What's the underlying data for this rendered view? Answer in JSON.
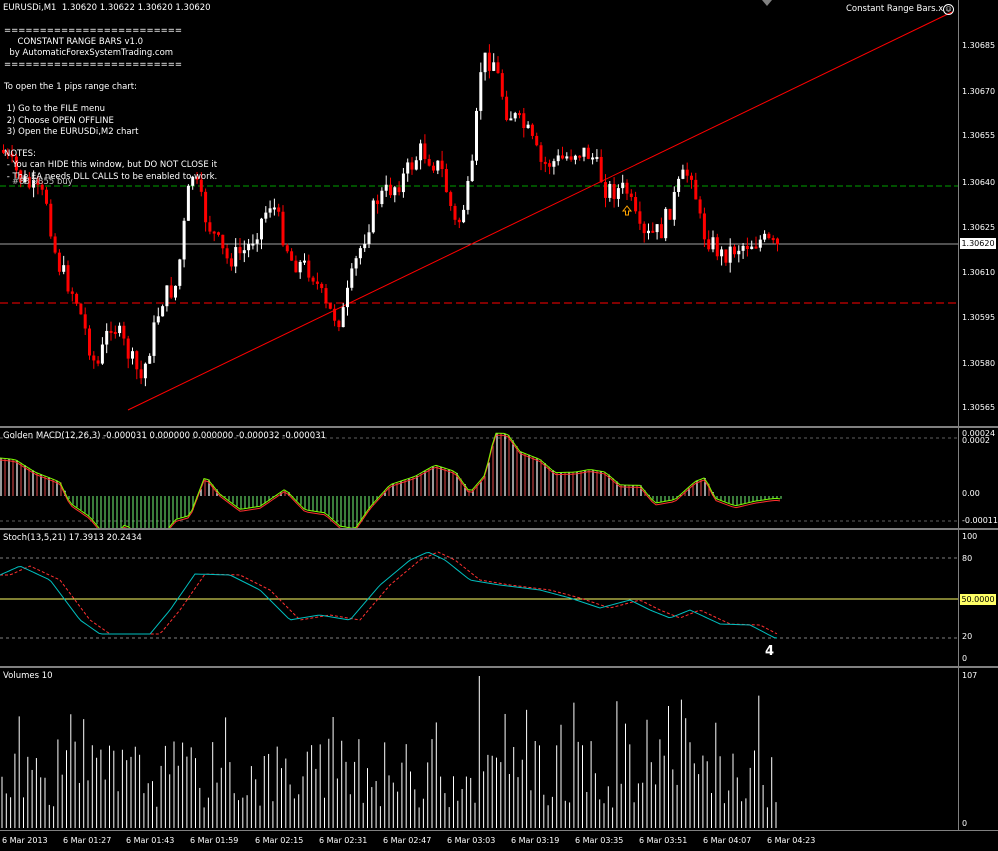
{
  "main": {
    "symbol_line": "EURUSDi,M1  1.30620 1.30622 1.30620 1.30620",
    "ea_label": "Constant Range Bars.x",
    "panel_lines": [
      "=========================",
      "     CONSTANT RANGE BARS v1.0",
      "  by AutomaticForexSystemTrading.com",
      "=========================",
      "",
      "To open the 1 pips range chart:",
      "",
      " 1) Go to the FILE menu",
      " 2) Choose OPEN OFFLINE",
      " 3) Open the EURUSDi,M2 chart",
      "",
      "NOTES:",
      " - You can HIDE this window, but DO NOT CLOSE it",
      " - The EA needs DLL CALLS to be enabled to work."
    ],
    "overlay_text": "#83 9855 buy",
    "price_ticks": [
      "1.30685",
      "1.30670",
      "1.30655",
      "1.30640",
      "1.30625",
      "1.30610",
      "1.30595",
      "1.30580",
      "1.30565"
    ],
    "current_price": "1.30620"
  },
  "macd": {
    "label": "Golden MACD(12,26,3) -0.000031 0.000000 0.000000 -0.000032 -0.000031",
    "ticks": [
      "0.00024",
      "0.0002",
      "0.00",
      "-0.00011"
    ]
  },
  "stoch": {
    "label": "Stoch(13,5,21) 17.3913 20.2434",
    "ticks": [
      "100",
      "80",
      "20",
      "0"
    ],
    "level_badge": "50.0000",
    "annotation": "4"
  },
  "volumes": {
    "label": "Volumes 10",
    "ticks": [
      "107",
      "0"
    ]
  },
  "time_axis": [
    "6 Mar 2013",
    "6 Mar 01:27",
    "6 Mar 01:43",
    "6 Mar 01:59",
    "6 Mar 02:15",
    "6 Mar 02:31",
    "6 Mar 02:47",
    "6 Mar 03:03",
    "6 Mar 03:19",
    "6 Mar 03:35",
    "6 Mar 03:51",
    "6 Mar 04:07",
    "6 Mar 04:23"
  ],
  "colors": {
    "bull": "#ffffff",
    "bear": "#ff0000",
    "grid_green": "#00a000",
    "level_red": "#ff0000",
    "trendline": "#ff0000",
    "macd_signal": "#ff3030",
    "macd_line": "#7cfc00",
    "stoch_main": "#00bfbf",
    "stoch_signal": "#ff3030",
    "stoch_mid": "#ffff66",
    "arrow": "#ffa500"
  }
}
